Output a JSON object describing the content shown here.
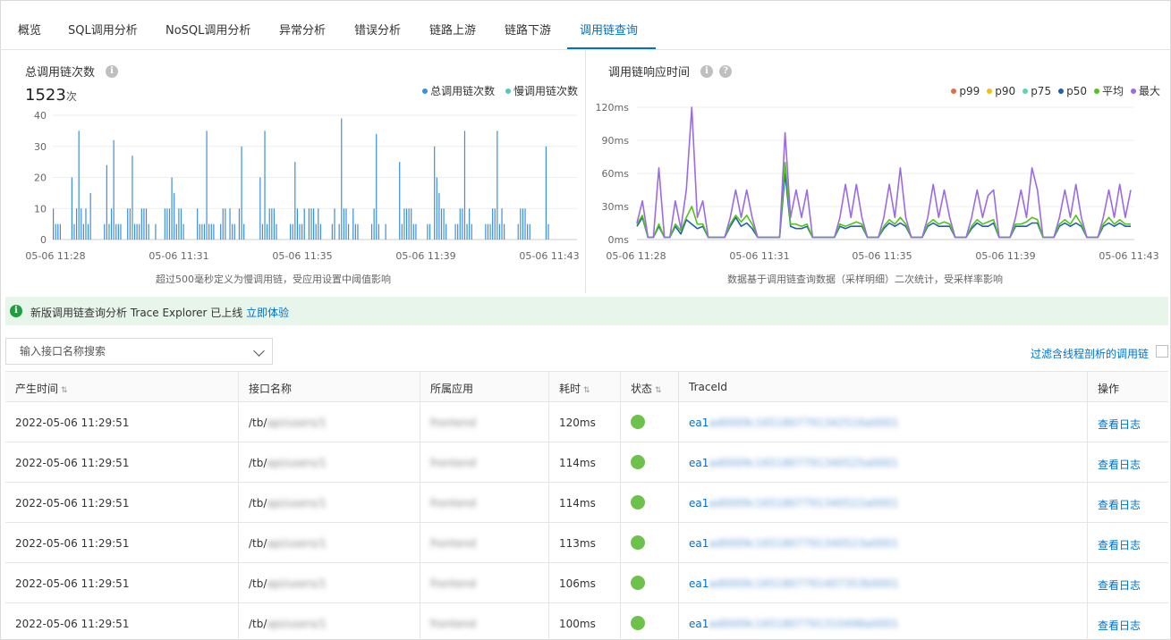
{
  "tabs": [
    {
      "label": "概览",
      "active": false
    },
    {
      "label": "SQL调用分析",
      "active": false
    },
    {
      "label": "NoSQL调用分析",
      "active": false
    },
    {
      "label": "异常分析",
      "active": false
    },
    {
      "label": "错误分析",
      "active": false
    },
    {
      "label": "链路上游",
      "active": false
    },
    {
      "label": "链路下游",
      "active": false
    },
    {
      "label": "调用链查询",
      "active": true
    }
  ],
  "count_panel": {
    "title": "总调用链次数",
    "total_value": "1523",
    "total_unit": "次",
    "footnote": "超过500毫秒定义为慢调用链，受应用设置中阈值影响"
  },
  "latency_panel": {
    "title": "调用链响应时间",
    "footnote": "数据基于调用链查询数据（采样明细）二次统计，受采样率影响"
  },
  "chart_data": [
    {
      "type": "bar",
      "title": "总调用链次数",
      "ylim": [
        0,
        40
      ],
      "yticks": [
        "0",
        "10",
        "20",
        "30",
        "40"
      ],
      "xticks": [
        "05-06 11:28",
        "05-06 11:31",
        "05-06 11:35",
        "05-06 11:39",
        "05-06 11:43"
      ],
      "legend_position": "top-right",
      "grid": true,
      "series": [
        {
          "name": "总调用链次数",
          "color": "#3b8fe0",
          "values": [
            10,
            5,
            5,
            5,
            0,
            0,
            0,
            0,
            20,
            5,
            10,
            35,
            10,
            5,
            10,
            5,
            15,
            0,
            0,
            0,
            0,
            0,
            5,
            24,
            5,
            10,
            32,
            5,
            5,
            5,
            0,
            0,
            10,
            10,
            27,
            5,
            5,
            5,
            10,
            10,
            10,
            5,
            0,
            0,
            5,
            0,
            0,
            0,
            10,
            10,
            10,
            20,
            15,
            5,
            10,
            10,
            5,
            0,
            0,
            0,
            0,
            0,
            10,
            5,
            5,
            5,
            35,
            5,
            5,
            5,
            0,
            0,
            5,
            10,
            10,
            0,
            10,
            5,
            5,
            0,
            10,
            30,
            5,
            0,
            0,
            0,
            0,
            0,
            0,
            20,
            5,
            35,
            5,
            10,
            10,
            10,
            5,
            0,
            0,
            0,
            0,
            0,
            5,
            5,
            25,
            10,
            5,
            5,
            10,
            0,
            10,
            10,
            10,
            5,
            10,
            5,
            0,
            0,
            0,
            0,
            5,
            10,
            0,
            5,
            39,
            10,
            10,
            5,
            0,
            10,
            5,
            5,
            0,
            0,
            0,
            0,
            0,
            5,
            10,
            34,
            5,
            0,
            0,
            5,
            0,
            0,
            0,
            0,
            0,
            25,
            5,
            10,
            10,
            10,
            10,
            5,
            5,
            0,
            0,
            0,
            0,
            5,
            5,
            0,
            30,
            20,
            15,
            10,
            10,
            5,
            0,
            0,
            0,
            5,
            5,
            10,
            10,
            35,
            5,
            10,
            5,
            0,
            0,
            0,
            0,
            0,
            5,
            5,
            5,
            10,
            10,
            35,
            5,
            10,
            5,
            0,
            0,
            0,
            0,
            0,
            5,
            10,
            10,
            10,
            5,
            5,
            0,
            0,
            0,
            0,
            0,
            0,
            30,
            5
          ]
        },
        {
          "name": "慢调用链次数",
          "color": "#4fc9b9",
          "values": []
        }
      ]
    },
    {
      "type": "line",
      "title": "调用链响应时间",
      "ylim": [
        0,
        120
      ],
      "yticks": [
        "0ms",
        "30ms",
        "60ms",
        "90ms",
        "120ms"
      ],
      "xticks": [
        "05-06 11:28",
        "05-06 11:31",
        "05-06 11:35",
        "05-06 11:39",
        "05-06 11:43"
      ],
      "legend_position": "top-right",
      "grid": true,
      "series": [
        {
          "name": "p99",
          "color": "#e8684a",
          "values": []
        },
        {
          "name": "p90",
          "color": "#f6bd16",
          "values": []
        },
        {
          "name": "p75",
          "color": "#5ad8a6",
          "values": []
        },
        {
          "name": "p50",
          "color": "#1e5fb4",
          "values": [
            12,
            20,
            2,
            2,
            12,
            2,
            2,
            12,
            5,
            18,
            14,
            10,
            12,
            2,
            2,
            2,
            2,
            12,
            20,
            12,
            15,
            10,
            2,
            2,
            2,
            2,
            2,
            60,
            12,
            10,
            10,
            12,
            2,
            2,
            2,
            2,
            2,
            12,
            10,
            12,
            12,
            12,
            2,
            2,
            2,
            10,
            15,
            12,
            15,
            12,
            2,
            2,
            2,
            12,
            15,
            12,
            12,
            12,
            2,
            2,
            2,
            10,
            15,
            12,
            12,
            15,
            2,
            2,
            2,
            12,
            12,
            12,
            15,
            15,
            2,
            2,
            2,
            12,
            15,
            12,
            15,
            12,
            2,
            2,
            2,
            12,
            15,
            12,
            15,
            12,
            12
          ]
        },
        {
          "name": "平均",
          "color": "#52c41a",
          "values": [
            14,
            22,
            2,
            2,
            14,
            2,
            2,
            14,
            8,
            20,
            30,
            14,
            14,
            2,
            2,
            2,
            2,
            14,
            22,
            16,
            22,
            14,
            2,
            2,
            2,
            2,
            2,
            70,
            14,
            14,
            12,
            14,
            2,
            2,
            2,
            2,
            2,
            14,
            12,
            14,
            16,
            14,
            2,
            2,
            2,
            12,
            18,
            14,
            20,
            14,
            2,
            2,
            2,
            14,
            18,
            14,
            16,
            14,
            2,
            2,
            2,
            12,
            18,
            14,
            16,
            18,
            2,
            2,
            2,
            14,
            14,
            16,
            20,
            18,
            2,
            2,
            2,
            14,
            18,
            14,
            22,
            14,
            2,
            2,
            2,
            14,
            20,
            14,
            18,
            14,
            14
          ]
        },
        {
          "name": "最大",
          "color": "#9b6ae6",
          "values": [
            15,
            35,
            2,
            2,
            65,
            2,
            2,
            35,
            10,
            45,
            120,
            20,
            35,
            2,
            2,
            2,
            2,
            20,
            45,
            20,
            45,
            20,
            2,
            2,
            2,
            2,
            2,
            97,
            20,
            45,
            20,
            45,
            2,
            2,
            2,
            2,
            2,
            20,
            50,
            20,
            50,
            20,
            2,
            2,
            2,
            20,
            50,
            20,
            65,
            20,
            2,
            2,
            2,
            20,
            50,
            20,
            45,
            20,
            2,
            2,
            2,
            20,
            45,
            20,
            40,
            45,
            2,
            2,
            2,
            20,
            45,
            20,
            65,
            45,
            2,
            2,
            2,
            20,
            45,
            20,
            50,
            20,
            2,
            2,
            2,
            20,
            45,
            20,
            50,
            20,
            45
          ]
        }
      ]
    }
  ],
  "notice": {
    "text": "新版调用链查询分析 Trace Explorer 已上线",
    "link": "立即体验"
  },
  "filter": {
    "search_placeholder": "输入接口名称搜索",
    "trace_filter_label": "过滤含线程剖析的调用链"
  },
  "table": {
    "columns": [
      "产生时间",
      "接口名称",
      "所属应用",
      "耗时",
      "状态",
      "TraceId",
      "操作"
    ],
    "rows": [
      {
        "time": "2022-05-06 11:29:51",
        "api_prefix": "/tb/",
        "api_rest": "api/users/1",
        "app": "frontend",
        "duration": "120ms",
        "trace_prefix": "ea1",
        "trace_rest": "ad0009c1651807791342516a0001",
        "action": "查看日志"
      },
      {
        "time": "2022-05-06 11:29:51",
        "api_prefix": "/tb/",
        "api_rest": "api/users/1",
        "app": "frontend",
        "duration": "114ms",
        "trace_prefix": "ea1",
        "trace_rest": "ad0009c1651807791340525a0001",
        "action": "查看日志"
      },
      {
        "time": "2022-05-06 11:29:51",
        "api_prefix": "/tb/",
        "api_rest": "api/users/1",
        "app": "frontend",
        "duration": "114ms",
        "trace_prefix": "ea1",
        "trace_rest": "ad0009c1651807791340522a0001",
        "action": "查看日志"
      },
      {
        "time": "2022-05-06 11:29:51",
        "api_prefix": "/tb/",
        "api_rest": "api/users/1",
        "app": "frontend",
        "duration": "113ms",
        "trace_prefix": "ea1",
        "trace_rest": "ad0009c1651807791340523a0001",
        "action": "查看日志"
      },
      {
        "time": "2022-05-06 11:29:51",
        "api_prefix": "/tb/",
        "api_rest": "api/users/1",
        "app": "frontend",
        "duration": "106ms",
        "trace_prefix": "ea1",
        "trace_rest": "ad0009c1651807791407353b0001",
        "action": "查看日志"
      },
      {
        "time": "2022-05-06 11:29:51",
        "api_prefix": "/tb/",
        "api_rest": "api/users/1",
        "app": "frontend",
        "duration": "100ms",
        "trace_prefix": "ea1",
        "trace_rest": "ad0009c1651807791310498a0001",
        "action": "查看日志"
      }
    ]
  },
  "colors": {
    "accent": "#0070cc",
    "success": "#6cc24a",
    "notice_bg": "#e8f5ea"
  }
}
